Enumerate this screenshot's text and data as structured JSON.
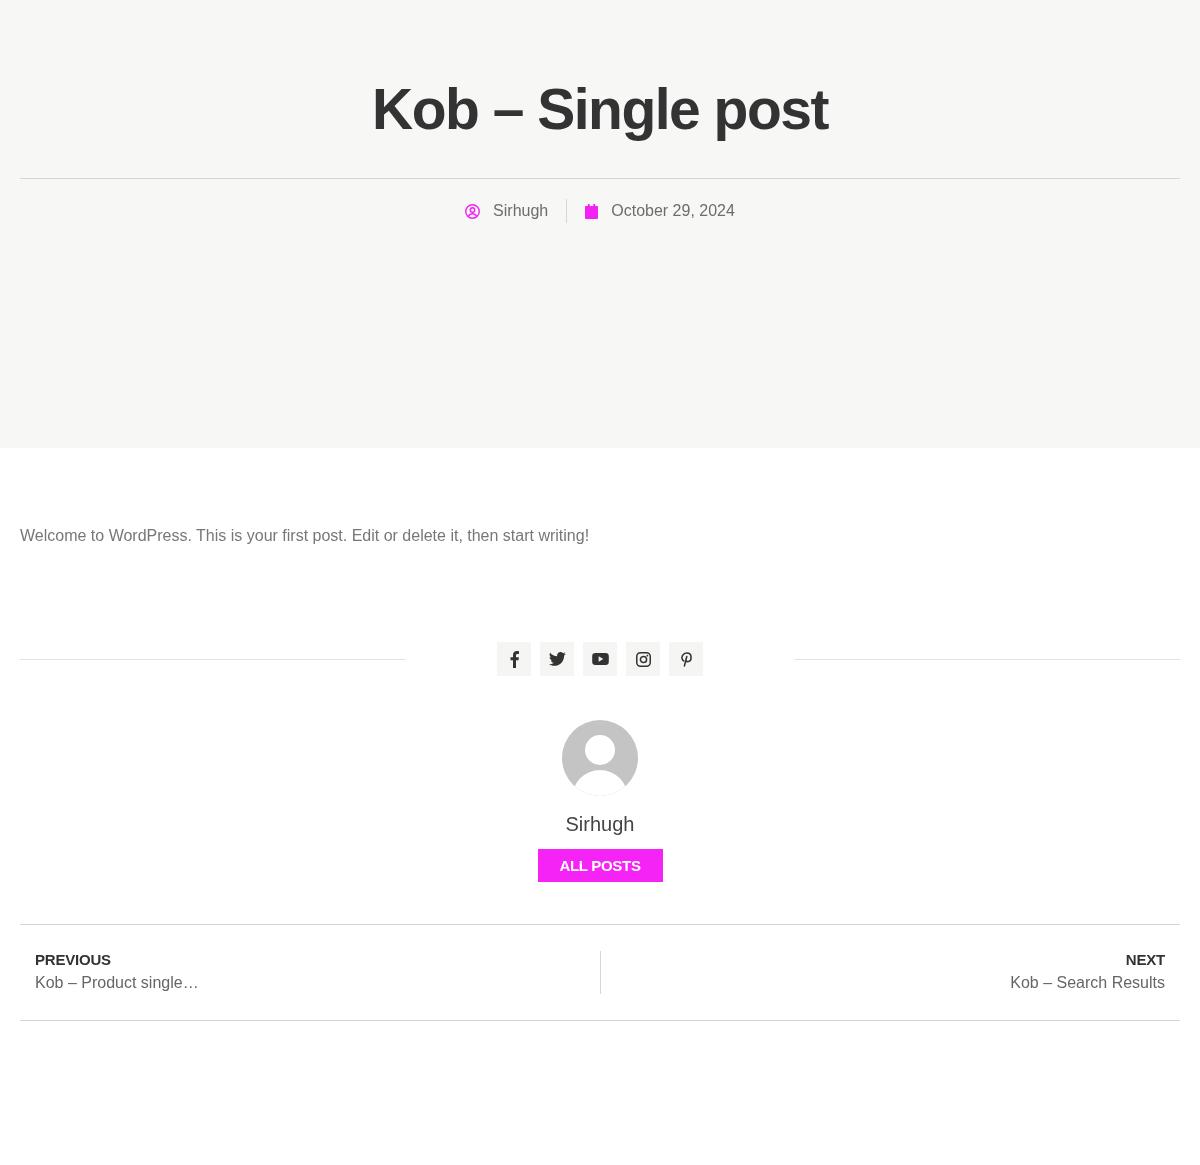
{
  "header": {
    "title": "Kob – Single post",
    "author": "Sirhugh",
    "date": "October 29, 2024"
  },
  "content": {
    "paragraph": "Welcome to WordPress. This is your first post. Edit or delete it, then start writing!"
  },
  "author_box": {
    "name": "Sirhugh",
    "button": "ALL POSTS"
  },
  "post_navigation": {
    "previous": {
      "label": "PREVIOUS",
      "title": "Kob – Product single…"
    },
    "next": {
      "label": "NEXT",
      "title": "Kob – Search Results"
    }
  }
}
